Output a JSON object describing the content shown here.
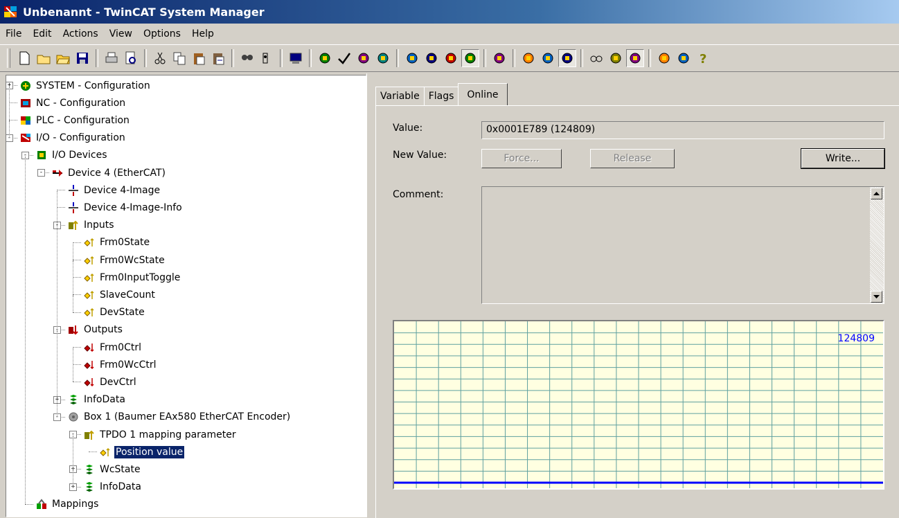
{
  "window": {
    "title": "Unbenannt - TwinCAT System Manager"
  },
  "menu": [
    "File",
    "Edit",
    "Actions",
    "View",
    "Options",
    "Help"
  ],
  "toolbar_icons": [
    "new-icon",
    "open-icon",
    "open-folder-icon",
    "save-icon",
    "|",
    "print-icon",
    "print-preview-icon",
    "|",
    "cut-icon",
    "copy-icon",
    "paste-icon",
    "paste-with-links-icon",
    "|",
    "find-icon",
    "find-next-icon",
    "|",
    "choose-target-icon",
    "|",
    "generate-mappings-icon",
    "check-configuration-icon",
    "activate-configuration-icon",
    "restart-tc-system-icon",
    "|",
    "restart-config-mode-icon",
    "reload-devices-icon",
    "scan-devices-icon",
    "toggle-free-run-icon",
    "|",
    "show-online-data-icon",
    "|",
    "show-sub-items-icon",
    "autoscroll-icon",
    "show-online-value-icon",
    "|",
    "goggles-icon",
    "connect-icon",
    "io-scan-icon",
    "|",
    "help-book-icon",
    "info-icon",
    "help-icon"
  ],
  "tree": [
    {
      "label": "SYSTEM - Configuration",
      "level": 0,
      "expander": "+",
      "icon": "system-icon"
    },
    {
      "label": "NC - Configuration",
      "level": 0,
      "expander": "",
      "icon": "nc-icon"
    },
    {
      "label": "PLC - Configuration",
      "level": 0,
      "expander": "",
      "icon": "plc-icon"
    },
    {
      "label": "I/O - Configuration",
      "level": 0,
      "expander": "-",
      "icon": "io-icon"
    },
    {
      "label": "I/O Devices",
      "level": 1,
      "expander": "-",
      "icon": "io-devices-icon"
    },
    {
      "label": "Device 4 (EtherCAT)",
      "level": 2,
      "expander": "-",
      "icon": "ethercat-device-icon"
    },
    {
      "label": "Device 4-Image",
      "level": 3,
      "expander": "",
      "icon": "image-icon"
    },
    {
      "label": "Device 4-Image-Info",
      "level": 3,
      "expander": "",
      "icon": "image-icon"
    },
    {
      "label": "Inputs",
      "level": 3,
      "expander": "-",
      "icon": "inputs-icon"
    },
    {
      "label": "Frm0State",
      "level": 4,
      "expander": "",
      "icon": "input-var-icon"
    },
    {
      "label": "Frm0WcState",
      "level": 4,
      "expander": "",
      "icon": "input-var-icon"
    },
    {
      "label": "Frm0InputToggle",
      "level": 4,
      "expander": "",
      "icon": "input-var-icon"
    },
    {
      "label": "SlaveCount",
      "level": 4,
      "expander": "",
      "icon": "input-var-icon"
    },
    {
      "label": "DevState",
      "level": 4,
      "expander": "",
      "icon": "input-var-icon"
    },
    {
      "label": "Outputs",
      "level": 3,
      "expander": "-",
      "icon": "outputs-icon"
    },
    {
      "label": "Frm0Ctrl",
      "level": 4,
      "expander": "",
      "icon": "output-var-icon"
    },
    {
      "label": "Frm0WcCtrl",
      "level": 4,
      "expander": "",
      "icon": "output-var-icon"
    },
    {
      "label": "DevCtrl",
      "level": 4,
      "expander": "",
      "icon": "output-var-icon"
    },
    {
      "label": "InfoData",
      "level": 3,
      "expander": "+",
      "icon": "infodata-icon"
    },
    {
      "label": "Box 1 (Baumer EAx580 EtherCAT Encoder)",
      "level": 3,
      "expander": "-",
      "icon": "box-icon"
    },
    {
      "label": "TPDO 1 mapping parameter",
      "level": 4,
      "expander": "-",
      "icon": "inputs-icon"
    },
    {
      "label": "Position value",
      "level": 5,
      "expander": "",
      "icon": "input-var-icon",
      "selected": true
    },
    {
      "label": "WcState",
      "level": 4,
      "expander": "+",
      "icon": "infodata-icon"
    },
    {
      "label": "InfoData",
      "level": 4,
      "expander": "+",
      "icon": "infodata-icon"
    },
    {
      "label": "Mappings",
      "level": 1,
      "expander": "",
      "icon": "mappings-icon"
    }
  ],
  "tabs": [
    {
      "label": "Variable",
      "active": false
    },
    {
      "label": "Flags",
      "active": false
    },
    {
      "label": "Online",
      "active": true
    }
  ],
  "online": {
    "value_label": "Value:",
    "value": "0x0001E789 (124809)",
    "new_value_label": "New Value:",
    "force_label": "Force...",
    "release_label": "Release",
    "write_label": "Write...",
    "comment_label": "Comment:",
    "comment": ""
  },
  "chart_data": {
    "type": "line",
    "value_label": "124809",
    "series": [
      {
        "values": [
          124809,
          124809
        ]
      }
    ],
    "grid": true,
    "colors": {
      "background": "#ffffe1",
      "grid": "#5fa0a0",
      "line": "#0000ff"
    }
  }
}
